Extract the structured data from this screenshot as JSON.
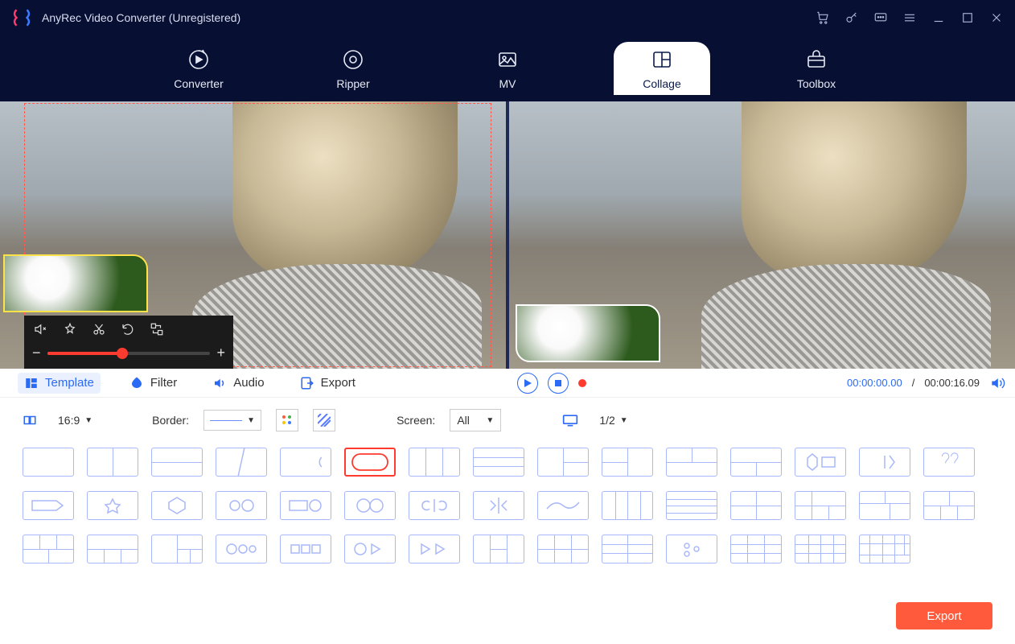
{
  "app": {
    "title": "AnyRec Video Converter (Unregistered)"
  },
  "nav": {
    "items": [
      {
        "label": "Converter"
      },
      {
        "label": "Ripper"
      },
      {
        "label": "MV"
      },
      {
        "label": "Collage"
      },
      {
        "label": "Toolbox"
      }
    ]
  },
  "tabs": {
    "template": "Template",
    "filter": "Filter",
    "audio": "Audio",
    "export": "Export"
  },
  "options": {
    "aspect": "16:9",
    "border_label": "Border:",
    "screen_label": "Screen:",
    "screen_value": "All",
    "split_value": "1/2"
  },
  "playback": {
    "current": "00:00:00.00",
    "total": "00:00:16.09",
    "separator": "/"
  },
  "export_button": "Export",
  "slider": {
    "minus": "−",
    "plus": "+"
  }
}
